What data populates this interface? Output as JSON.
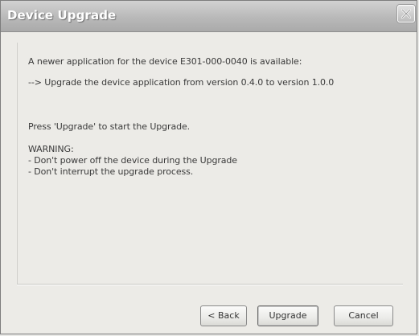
{
  "window": {
    "title": "Device Upgrade"
  },
  "message": {
    "line1": "A newer application for the device E301-000-0040 is available:",
    "line2": "--> Upgrade the device application from version 0.4.0 to version 1.0.0",
    "line3": "Press 'Upgrade' to start the Upgrade.",
    "warning_title": "WARNING:",
    "warning_1": "- Don't power off the device during the Upgrade",
    "warning_2": "- Don't interrupt the upgrade process."
  },
  "buttons": {
    "back": "< Back",
    "upgrade": "Upgrade",
    "cancel": "Cancel"
  },
  "icons": {
    "close": "close-icon"
  }
}
